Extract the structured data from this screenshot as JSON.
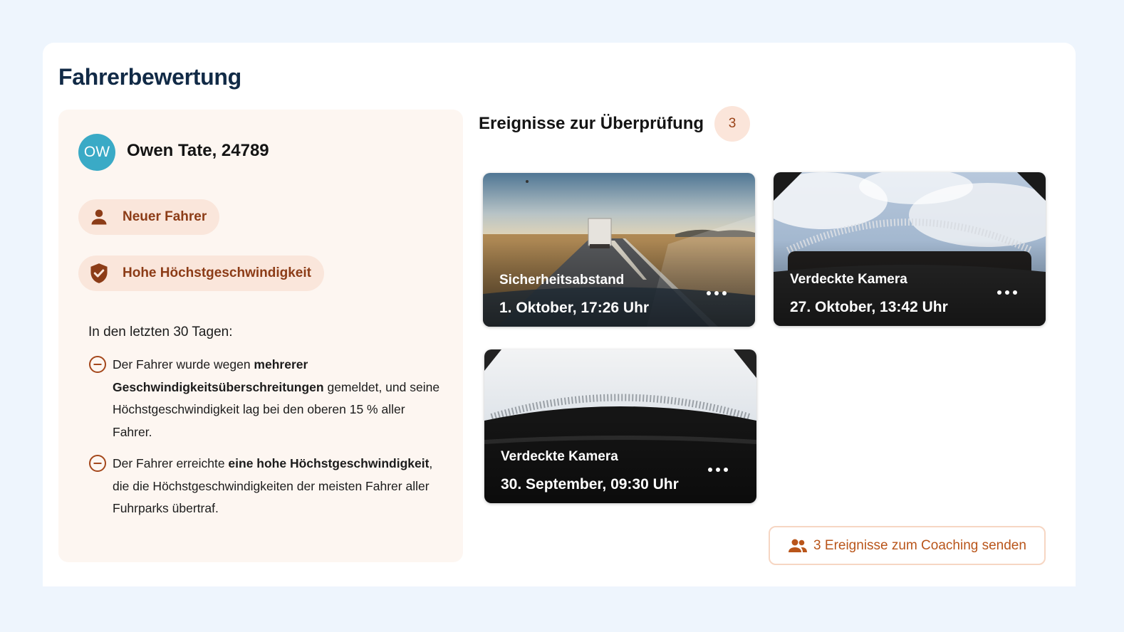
{
  "page_title": "Fahrerbewertung",
  "driver": {
    "initials": "OW",
    "name": "Owen Tate, 24789",
    "tags": [
      {
        "label": "Neuer Fahrer",
        "icon": "person-icon"
      },
      {
        "label": "Hohe Höchstgeschwindigkeit",
        "icon": "shield-check-icon"
      }
    ],
    "period_label": "In den letzten 30 Tagen:",
    "findings": [
      {
        "before": "Der Fahrer wurde wegen ",
        "bold": "mehrerer Geschwindigkeitsüberschreitungen",
        "after": " gemeldet, und seine Höchstgeschwindigkeit lag bei den oberen 15 % aller Fahrer."
      },
      {
        "before": "Der Fahrer erreichte ",
        "bold": "eine hohe Höchstgeschwindigkeit",
        "after": ", die die Höchstgeschwindigkeiten der meisten Fahrer aller Fuhrparks übertraf."
      }
    ]
  },
  "events": {
    "title": "Ereignisse zur Überprüfung",
    "count": "3",
    "items": [
      {
        "type": "Sicherheitsabstand",
        "date": "1. Oktober, 17:26 Uhr"
      },
      {
        "type": "Verdeckte Kamera",
        "date": "27. Oktober, 13:42 Uhr"
      },
      {
        "type": "Verdeckte Kamera",
        "date": "30. September, 09:30 Uhr"
      }
    ]
  },
  "coaching_button": "3 Ereignisse zum Coaching senden",
  "colors": {
    "accent": "#b9551a",
    "tag_bg": "#fae6db",
    "panel_bg": "#fdf6f1",
    "avatar": "#3aaac6",
    "title": "#112a46"
  }
}
